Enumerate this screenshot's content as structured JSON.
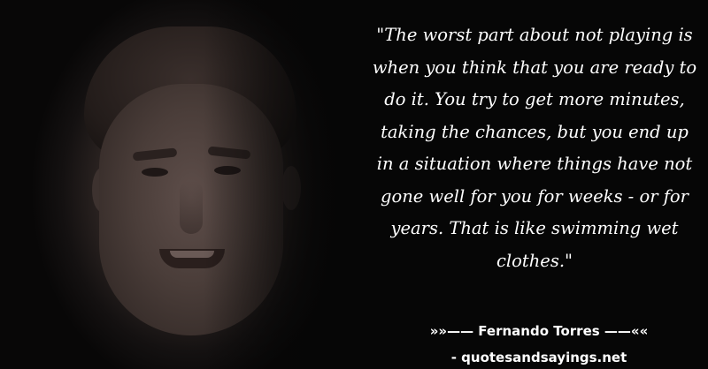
{
  "quote": {
    "text": "\"The worst part about not playing is when you think that you are ready to do it. You try to get more minutes, taking the chances, but you end up in a situation where things have not gone well for you for weeks - or for years. That is like swimming wet clothes.\""
  },
  "attribution": {
    "author_line": "»»—— Fernando Torres ——««",
    "source_line": "- quotesandsayings.net"
  }
}
